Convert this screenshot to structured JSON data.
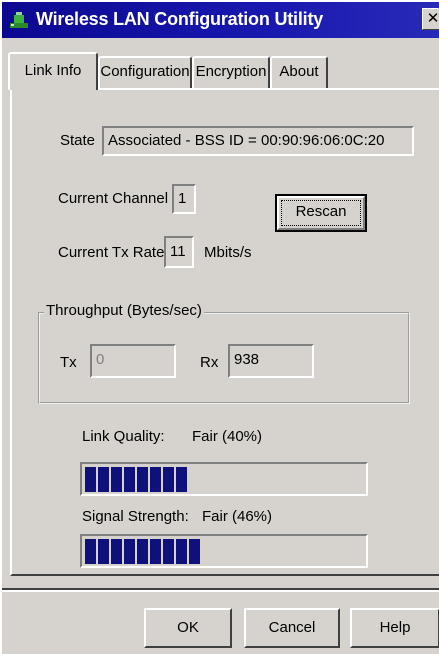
{
  "window": {
    "title": "Wireless LAN Configuration Utility",
    "close_glyph": "✕",
    "app_icon": "network-adapter-icon",
    "title_bar_color": "#1410a0"
  },
  "tabs": [
    {
      "label": "Link Info",
      "active": true
    },
    {
      "label": "Configuration",
      "active": false
    },
    {
      "label": "Encryption",
      "active": false
    },
    {
      "label": "About",
      "active": false
    }
  ],
  "link_info": {
    "state_label": "State",
    "state_value": "Associated - BSS ID = 00:90:96:06:0C:20",
    "channel_label": "Current Channel",
    "channel_value": "1",
    "tx_rate_label": "Current Tx Rate",
    "tx_rate_value": "11",
    "tx_rate_unit": "Mbits/s",
    "rescan_label": "Rescan"
  },
  "throughput": {
    "title": "Throughput (Bytes/sec)",
    "tx_label": "Tx",
    "tx_value": "0",
    "rx_label": "Rx",
    "rx_value": "938"
  },
  "link_quality": {
    "label": "Link Quality:",
    "value_text": "Fair (40%)",
    "percent": 40
  },
  "signal_strength": {
    "label": "Signal Strength:",
    "value_text": "Fair (46%)",
    "percent": 46
  },
  "buttons": {
    "ok": "OK",
    "cancel": "Cancel",
    "help": "Help"
  },
  "colors": {
    "progress_fill": "#10107a",
    "face": "#d6d3ce"
  }
}
